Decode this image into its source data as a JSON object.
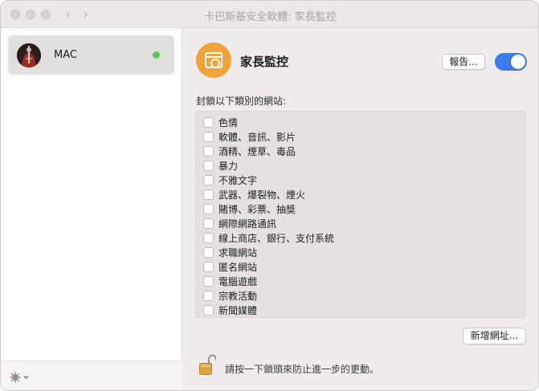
{
  "window": {
    "title": "卡巴斯基安全軟體: 家長監控",
    "back_glyph": "‹",
    "forward_glyph": "›"
  },
  "sidebar": {
    "items": [
      {
        "label": "MAC",
        "status_color": "#5dc456"
      }
    ],
    "settings_icon": "gear-icon"
  },
  "main": {
    "title": "家長監控",
    "report_label": "報告...",
    "toggle_on": true,
    "section_label": "封鎖以下類別的網站:",
    "categories": [
      {
        "label": "色情",
        "checked": false
      },
      {
        "label": "軟體、音訊、影片",
        "checked": false
      },
      {
        "label": "酒精、煙草、毒品",
        "checked": false
      },
      {
        "label": "暴力",
        "checked": false
      },
      {
        "label": "不雅文字",
        "checked": false
      },
      {
        "label": "武器、爆裂物、煙火",
        "checked": false
      },
      {
        "label": "賭博、彩票、抽獎",
        "checked": false
      },
      {
        "label": "網際網路通訊",
        "checked": false
      },
      {
        "label": "線上商店、銀行、支付系統",
        "checked": false
      },
      {
        "label": "求職網站",
        "checked": false
      },
      {
        "label": "匿名網站",
        "checked": false
      },
      {
        "label": "電腦遊戲",
        "checked": false
      },
      {
        "label": "宗教活動",
        "checked": false
      },
      {
        "label": "新聞媒體",
        "checked": false
      }
    ],
    "add_site_label": "新增網址...",
    "lock_text": "請按一下鎖頭來防止進一步的更動。"
  },
  "colors": {
    "accent": "#3e7bea",
    "app_icon": "#f0a33b",
    "online": "#5dc456"
  }
}
